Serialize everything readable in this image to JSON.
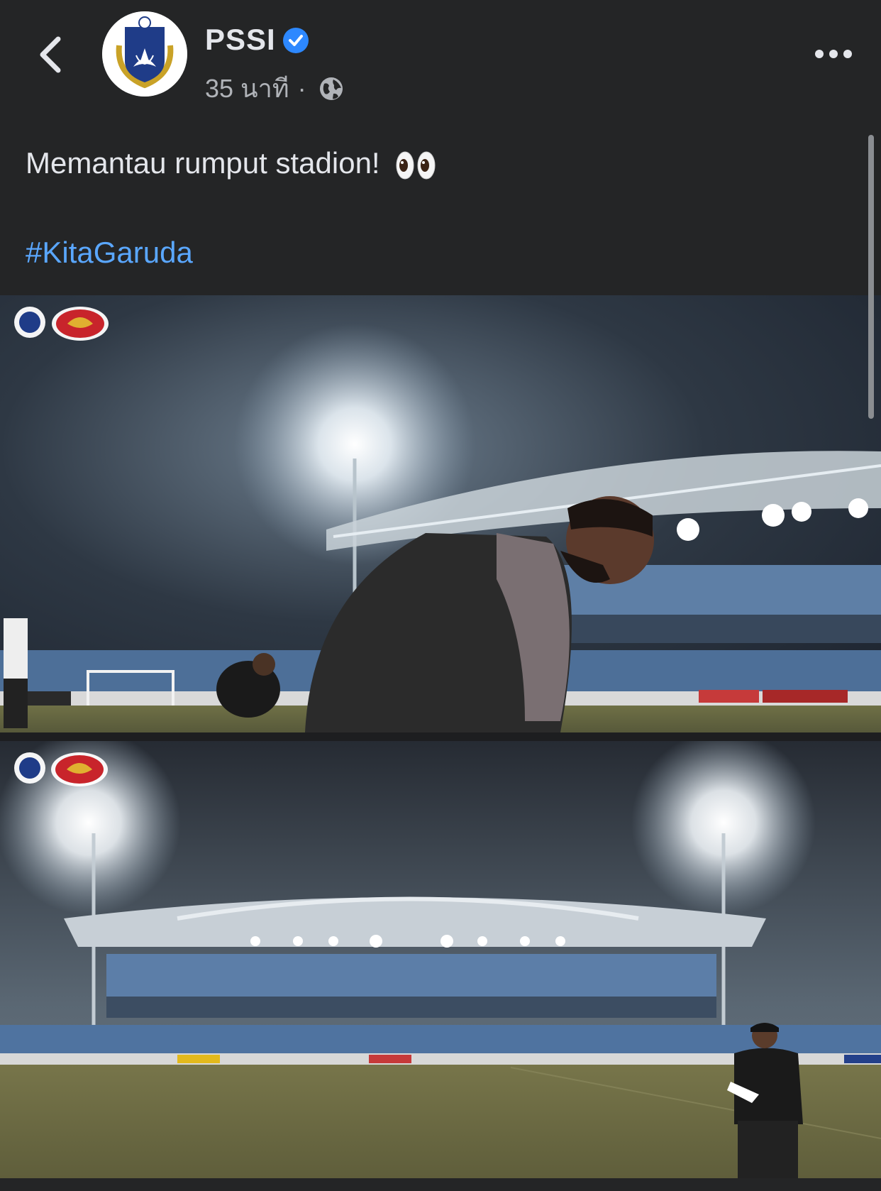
{
  "header": {
    "page_name": "PSSI",
    "timestamp": "35 นาที",
    "separator": "·",
    "back_icon": "chevron-left-icon",
    "verified_icon": "verified-badge-icon",
    "privacy_icon": "globe-icon",
    "more_icon": "more-horizontal-icon"
  },
  "post": {
    "text": "Memantau rumput stadion!",
    "emoji": "eyes-emoji",
    "hashtag": "#KitaGaruda"
  },
  "photos": [
    {
      "name": "stadium-photo-player-kneeling",
      "logos": [
        "pssi-logo",
        "garuda-logo"
      ]
    },
    {
      "name": "stadium-photo-coach-standing",
      "logos": [
        "pssi-logo",
        "garuda-logo"
      ]
    }
  ],
  "colors": {
    "background": "#242526",
    "text": "#e4e6eb",
    "secondary_text": "#b0b3b8",
    "link": "#5aa7ff",
    "verified": "#2d88ff"
  }
}
